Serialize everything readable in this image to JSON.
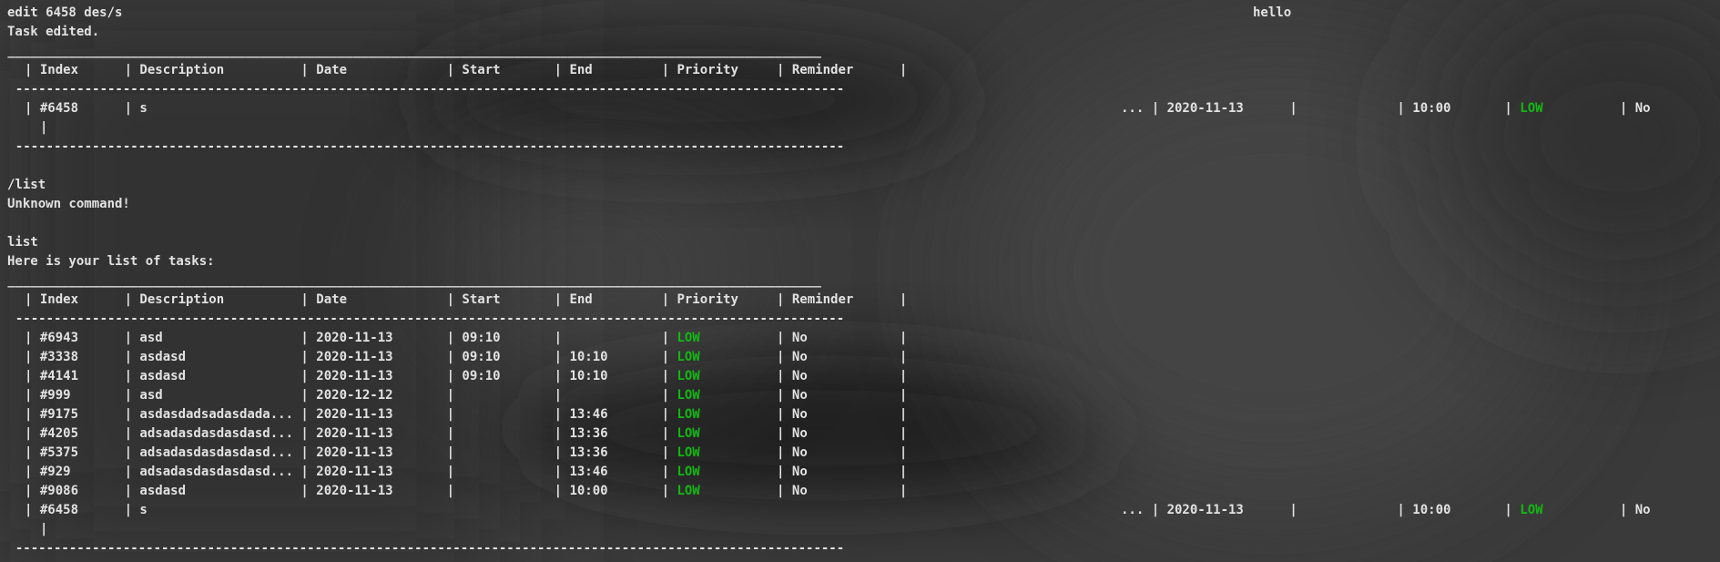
{
  "window": {
    "title_right": "hello"
  },
  "output": {
    "cmd1": "edit 6458 des/s",
    "msg1": "Task edited.",
    "cmd2": "/list",
    "msg2": "Unknown command!",
    "cmd3": "list",
    "msg3": "Here is your list of tasks:"
  },
  "table": {
    "top_border": " __________________________________________________________________________________________________________",
    "header": "| Index      | Description          | Date             | Start       | End         | Priority     | Reminder      |",
    "divider": "  ------------------------------------------------------------------------------------------------------------",
    "bottom_border": "  ------------------------------------------------------------------------------------------------------------"
  },
  "colors": {
    "priority_low": "#13b813",
    "text": "#e2e2e2",
    "background": "#353535"
  },
  "edited_task": {
    "left": "| #6458      | s",
    "right_pre": "... | 2020-11-13      |             | 10:00       | ",
    "priority": "LOW",
    "right_post": "          | No",
    "wrap": "|"
  },
  "tasks": [
    {
      "pre": "| #6943      | asd                  | 2020-11-13       | 09:10       |             | ",
      "priority": "LOW",
      "post": "          | No            |"
    },
    {
      "pre": "| #3338      | asdasd               | 2020-11-13       | 09:10       | 10:10       | ",
      "priority": "LOW",
      "post": "          | No            |"
    },
    {
      "pre": "| #4141      | asdasd               | 2020-11-13       | 09:10       | 10:10       | ",
      "priority": "LOW",
      "post": "          | No            |"
    },
    {
      "pre": "| #999       | asd                  | 2020-12-12       |             |             | ",
      "priority": "LOW",
      "post": "          | No            |"
    },
    {
      "pre": "| #9175      | asdasdadsadasdada... | 2020-11-13       |             | 13:46       | ",
      "priority": "LOW",
      "post": "          | No            |"
    },
    {
      "pre": "| #4205      | adsadasdasdasdasd... | 2020-11-13       |             | 13:36       | ",
      "priority": "LOW",
      "post": "          | No            |"
    },
    {
      "pre": "| #5375      | adsadasdasdasdasd... | 2020-11-13       |             | 13:36       | ",
      "priority": "LOW",
      "post": "          | No            |"
    },
    {
      "pre": "| #929       | adsadasdasdasdasd... | 2020-11-13       |             | 13:46       | ",
      "priority": "LOW",
      "post": "          | No            |"
    },
    {
      "pre": "| #9086      | asdasd               | 2020-11-13       |             | 10:00       | ",
      "priority": "LOW",
      "post": "          | No            |"
    }
  ],
  "last_task": {
    "left": "| #6458      | s",
    "right_pre": "... | 2020-11-13      |             | 10:00       | ",
    "priority": "LOW",
    "right_post": "          | No",
    "wrap": "|"
  }
}
